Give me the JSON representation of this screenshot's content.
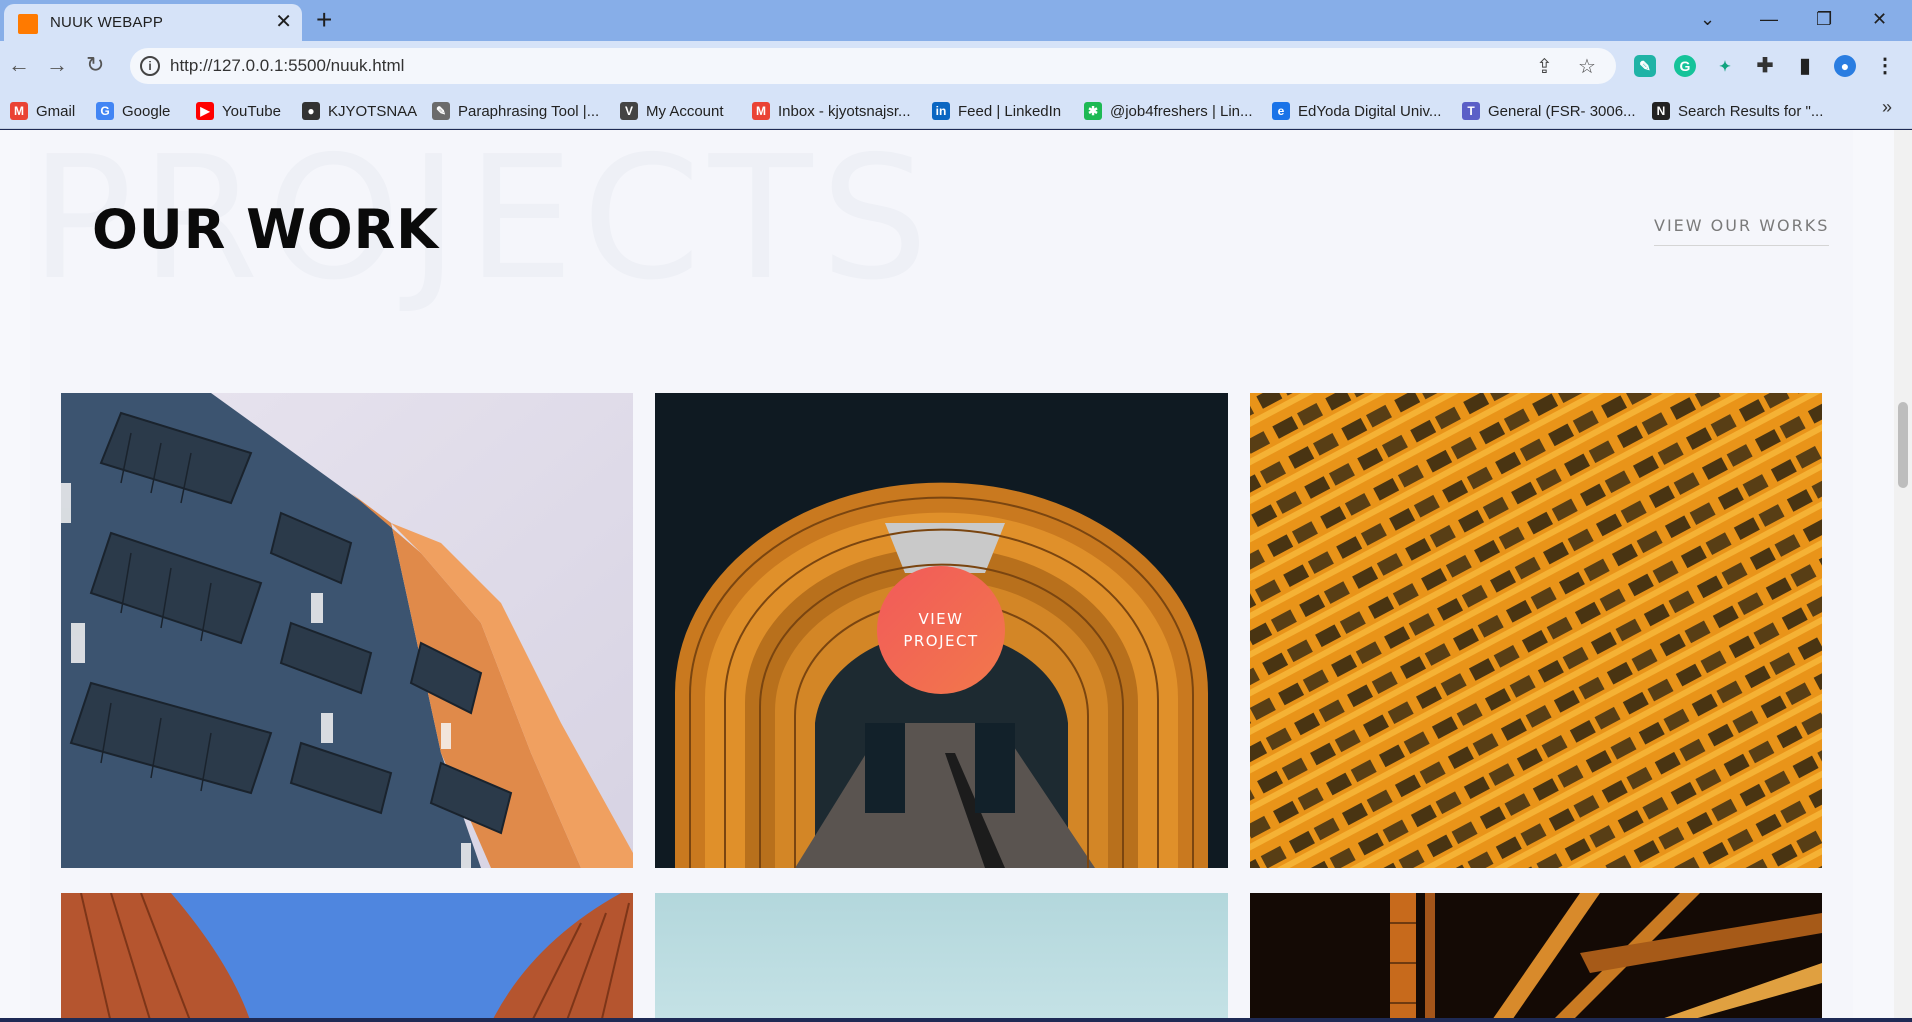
{
  "browser": {
    "tab_title": "NUUK WEBAPP",
    "tab_close": "✕",
    "new_tab": "+",
    "url": "http://127.0.0.1:5500/nuuk.html",
    "window_controls": {
      "dropdown": "⌄",
      "minimize": "—",
      "restore": "❐",
      "close": "✕"
    },
    "bookmarks": [
      {
        "label": "Gmail",
        "icon": "gmail-icon",
        "color": "#ea4335",
        "glyph": "M"
      },
      {
        "label": "Google",
        "icon": "google-icon",
        "color": "#4285f4",
        "glyph": "G"
      },
      {
        "label": "YouTube",
        "icon": "youtube-icon",
        "color": "#ff0000",
        "glyph": "▶"
      },
      {
        "label": "KJYOTSNAA",
        "icon": "github-icon",
        "color": "#333333",
        "glyph": "●"
      },
      {
        "label": "Paraphrasing Tool |...",
        "icon": "quill-icon",
        "color": "#6b6b6b",
        "glyph": "✎"
      },
      {
        "label": "My Account",
        "icon": "vit-icon",
        "color": "#444444",
        "glyph": "V"
      },
      {
        "label": "Inbox - kjyotsnajsr...",
        "icon": "gmail-icon",
        "color": "#ea4335",
        "glyph": "M"
      },
      {
        "label": "Feed | LinkedIn",
        "icon": "linkedin-icon",
        "color": "#0a66c2",
        "glyph": "in"
      },
      {
        "label": "@job4freshers | Lin...",
        "icon": "asterisk-icon",
        "color": "#1db954",
        "glyph": "✱"
      },
      {
        "label": "EdYoda Digital Univ...",
        "icon": "edyoda-icon",
        "color": "#1a73e8",
        "glyph": "e"
      },
      {
        "label": "General (FSR- 3006...",
        "icon": "teams-icon",
        "color": "#5b5fc7",
        "glyph": "T"
      },
      {
        "label": "Search Results for \"...",
        "icon": "search-results-icon",
        "color": "#222222",
        "glyph": "N"
      }
    ],
    "bookmarks_more": "»"
  },
  "page": {
    "watermark": "PROJECTS",
    "section_title": "OUR WORK",
    "view_works_link": "VIEW OUR WORKS",
    "view_project_line1": "VIEW",
    "view_project_line2": "PROJECT",
    "gallery": [
      {
        "name": "project-apartment-balconies",
        "theme": "blue-orange-building"
      },
      {
        "name": "project-orange-tunnel",
        "theme": "dark-tunnel"
      },
      {
        "name": "project-orange-facade",
        "theme": "orange-grid-building"
      },
      {
        "name": "project-curved-roofs",
        "theme": "blue-sky-red-curves"
      },
      {
        "name": "project-teal-sky",
        "theme": "pale-teal"
      },
      {
        "name": "project-orange-bridge",
        "theme": "dark-bridge"
      }
    ]
  },
  "colors": {
    "accent_gradient_start": "#f25a5a",
    "accent_gradient_end": "#f2784b",
    "chrome": "#d6e3f8",
    "titlebar": "#87aee8"
  }
}
